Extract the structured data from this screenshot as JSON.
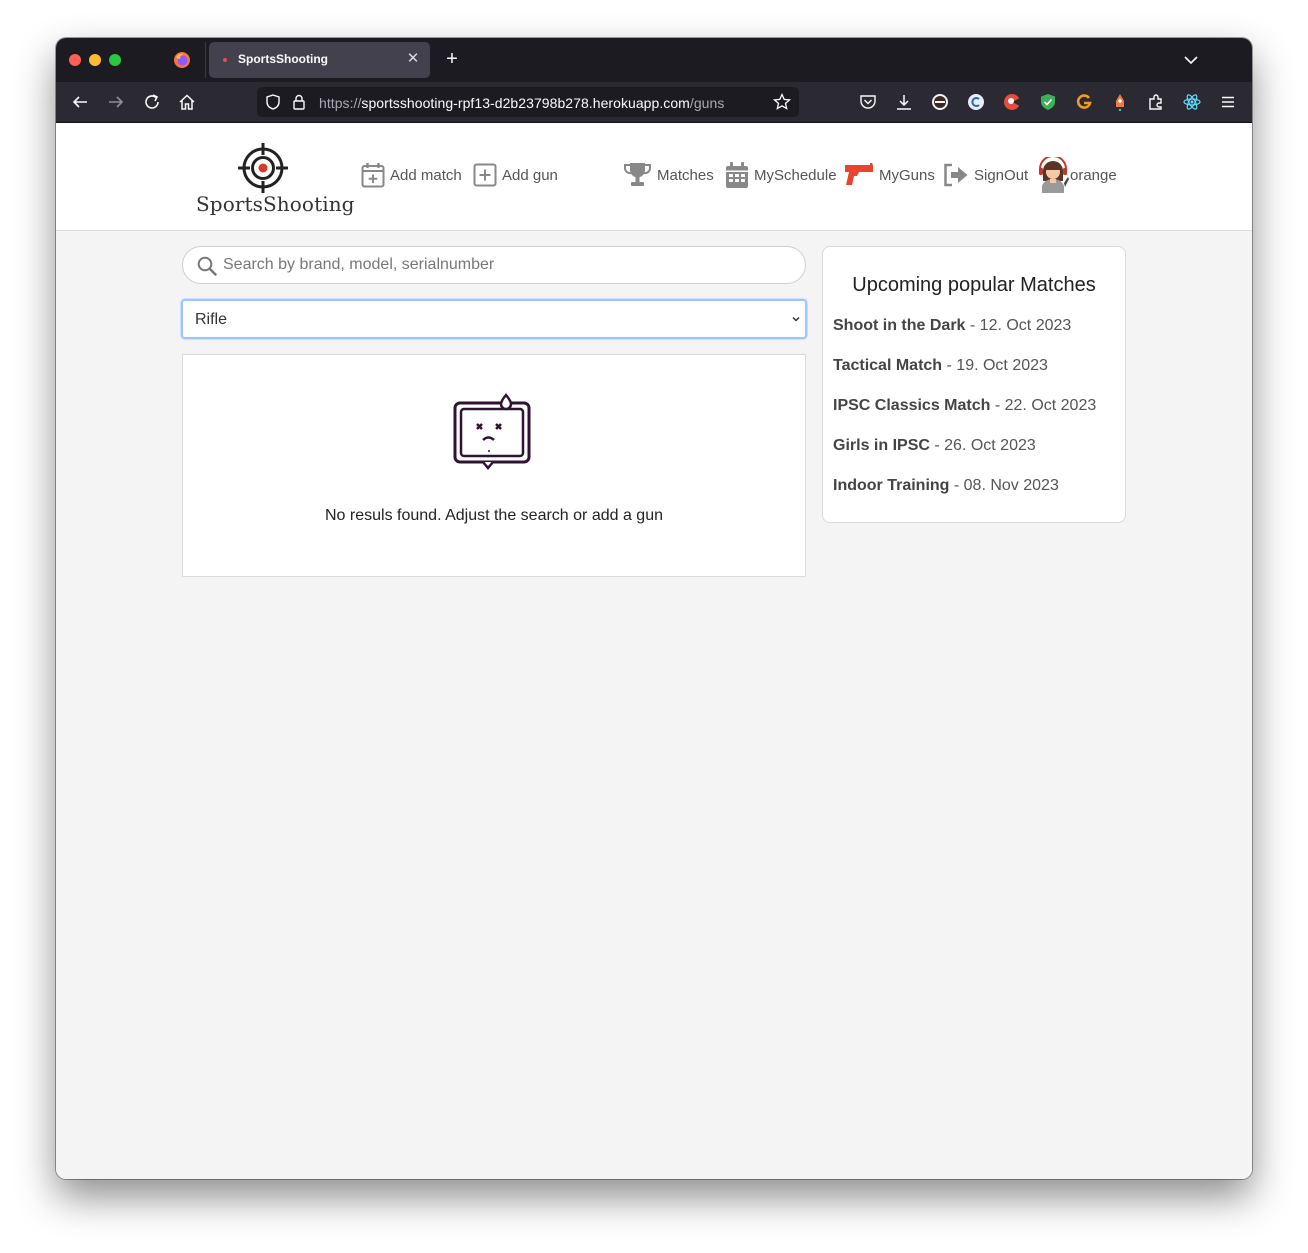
{
  "browser": {
    "tab_title": "SportsShooting",
    "url_scheme": "https://",
    "url_host": "sportsshooting-rpf13-d2b23798b278.herokuapp.com",
    "url_path": "/guns"
  },
  "header": {
    "logo_text": "SportsShooting",
    "nav": {
      "add_match": "Add match",
      "add_gun": "Add gun",
      "matches": "Matches",
      "my_schedule": "MySchedule",
      "my_guns": "MyGuns",
      "sign_out": "SignOut",
      "user": "orange"
    },
    "accent_color": "#e8452c"
  },
  "search": {
    "placeholder": "Search by brand, model, serialnumber",
    "value": ""
  },
  "filter": {
    "selected": "Rifle"
  },
  "results": {
    "empty_message": "No resuls found. Adjust the search or add a gun"
  },
  "sidebar": {
    "title": "Upcoming popular Matches",
    "matches": [
      {
        "name": "Shoot in the Dark",
        "date": " - 12. Oct 2023"
      },
      {
        "name": "Tactical Match",
        "date": " - 19. Oct 2023"
      },
      {
        "name": "IPSC Classics Match",
        "date": " - 22. Oct 2023"
      },
      {
        "name": "Girls in IPSC",
        "date": " - 26. Oct 2023"
      },
      {
        "name": "Indoor Training",
        "date": " - 08. Nov 2023"
      }
    ]
  }
}
